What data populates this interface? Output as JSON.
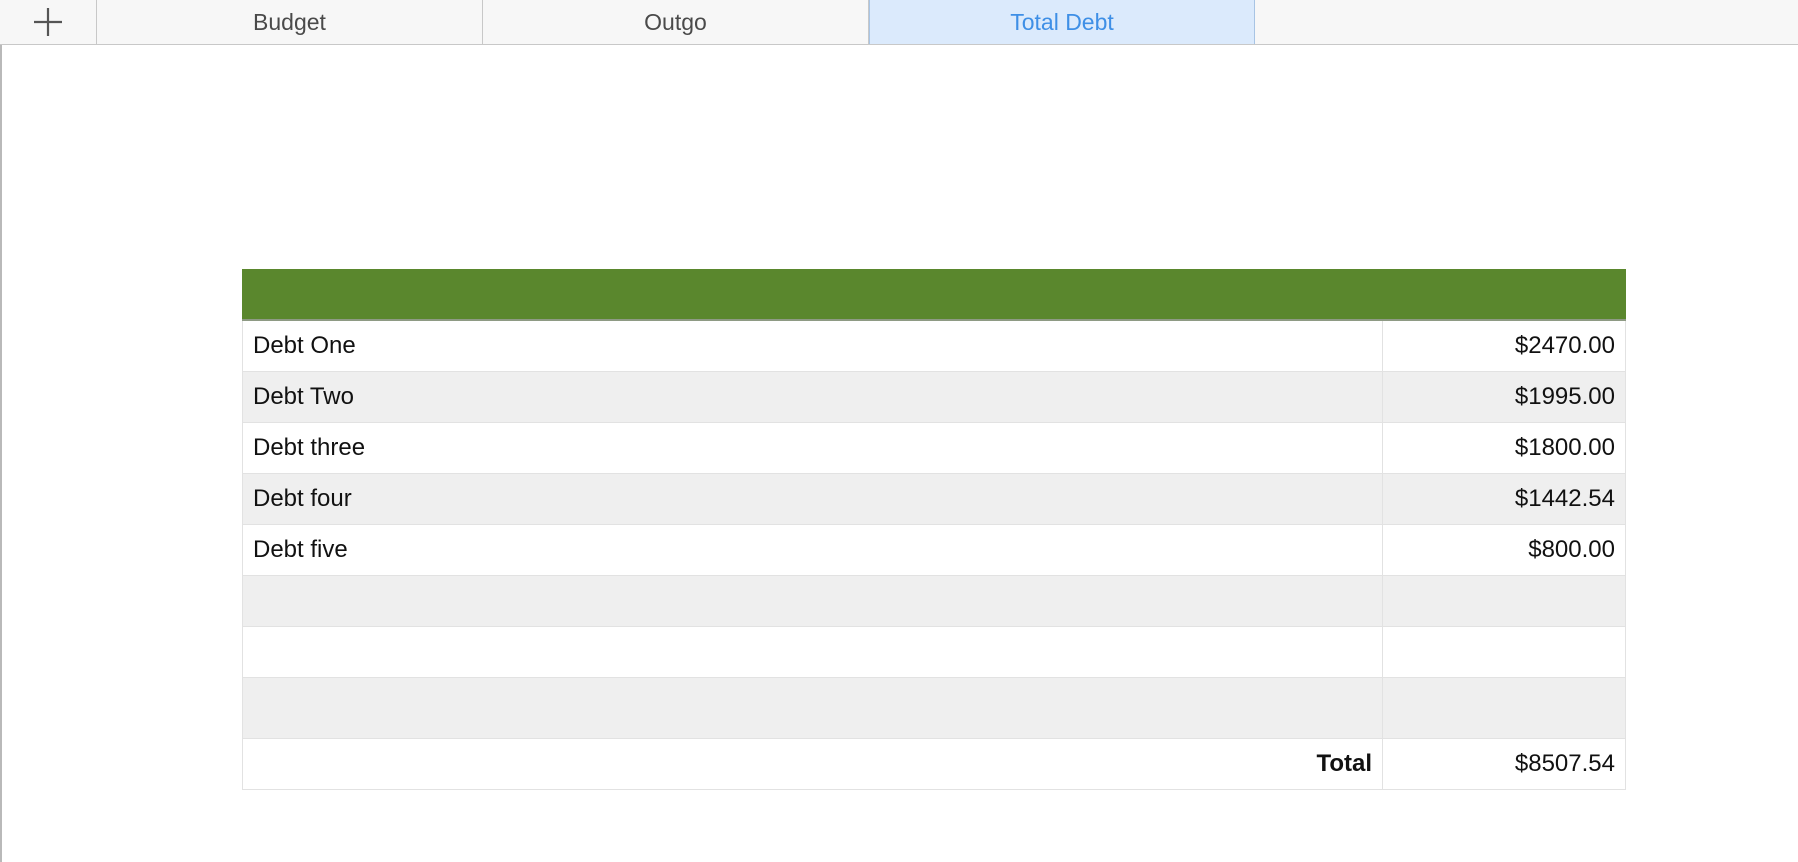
{
  "tabs": [
    {
      "label": "Budget",
      "active": false
    },
    {
      "label": "Outgo",
      "active": false
    },
    {
      "label": "Total Debt",
      "active": true
    }
  ],
  "table": {
    "header_color": "#5a872d",
    "rows": [
      {
        "name": "Debt One",
        "amount": "$2470.00"
      },
      {
        "name": "Debt Two",
        "amount": "$1995.00"
      },
      {
        "name": "Debt three",
        "amount": "$1800.00"
      },
      {
        "name": "Debt four",
        "amount": "$1442.54"
      },
      {
        "name": "Debt five",
        "amount": "$800.00"
      },
      {
        "name": "",
        "amount": ""
      },
      {
        "name": "",
        "amount": ""
      },
      {
        "name": "",
        "amount": ""
      }
    ],
    "total_label": "Total",
    "total_amount": "$8507.54"
  },
  "icons": {
    "add_sheet": "plus-icon"
  }
}
